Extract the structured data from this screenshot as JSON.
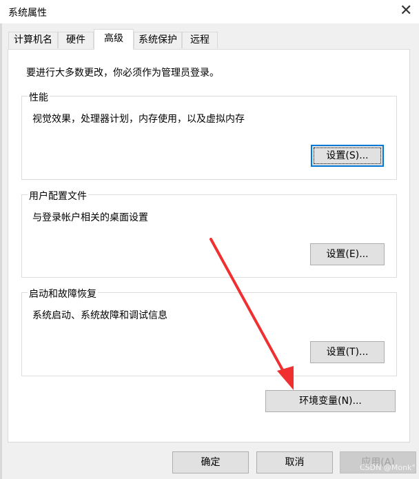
{
  "window": {
    "title": "系统属性"
  },
  "tabs": [
    {
      "label": "计算机名",
      "active": false
    },
    {
      "label": "硬件",
      "active": false
    },
    {
      "label": "高级",
      "active": true
    },
    {
      "label": "系统保护",
      "active": false
    },
    {
      "label": "远程",
      "active": false
    }
  ],
  "advanced": {
    "admin_note": "要进行大多数更改，你必须作为管理员登录。",
    "performance": {
      "title": "性能",
      "description": "视觉效果，处理器计划，内存使用，以及虚拟内存",
      "button": "设置(S)..."
    },
    "user_profiles": {
      "title": "用户配置文件",
      "description": "与登录帐户相关的桌面设置",
      "button": "设置(E)..."
    },
    "startup_recovery": {
      "title": "启动和故障恢复",
      "description": "系统启动、系统故障和调试信息",
      "button": "设置(T)..."
    },
    "env_vars_button": "环境变量(N)..."
  },
  "footer": {
    "ok": "确定",
    "cancel": "取消",
    "apply": "应用(A)"
  },
  "watermark": "CSDN @Monk°",
  "colors": {
    "annotation_arrow": "#f03030",
    "focus_border": "#0078d7"
  }
}
